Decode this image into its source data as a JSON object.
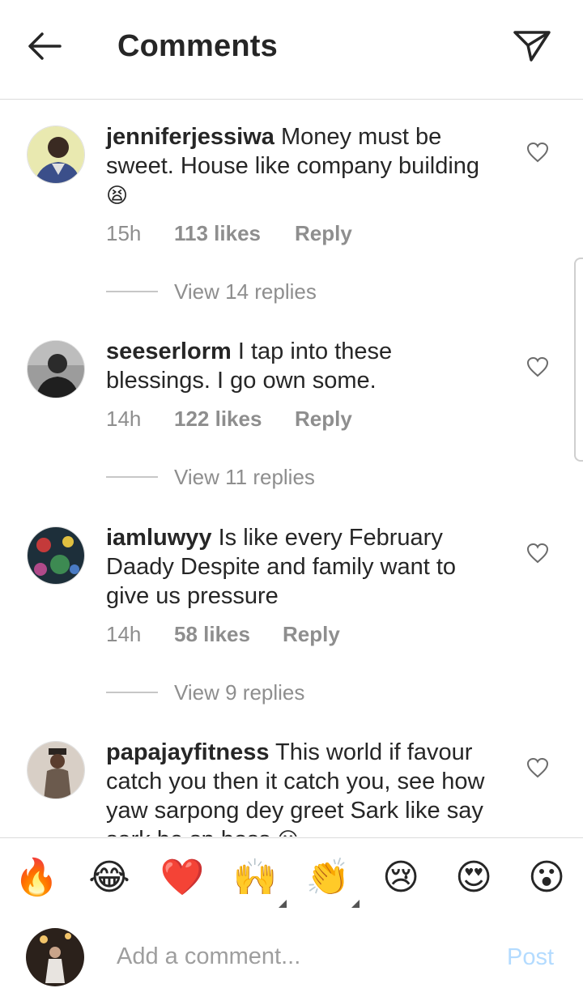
{
  "header": {
    "title": "Comments",
    "back_icon": "arrow-left-icon",
    "send_icon": "paper-plane-icon"
  },
  "comments": [
    {
      "username": "jenniferjessiwa",
      "text": "Money must be sweet. House like company building",
      "emoji": "😫",
      "time": "15h",
      "likes": "113 likes",
      "reply": "Reply",
      "view_replies": "View 14 replies"
    },
    {
      "username": "seeserlorm",
      "text": "I tap into these blessings. I go own some.",
      "time": "14h",
      "likes": "122 likes",
      "reply": "Reply",
      "view_replies": "View 11 replies"
    },
    {
      "username": "iamluwyy",
      "text": "Is like every February Daady Despite and family want to give us pressure",
      "time": "14h",
      "likes": "58 likes",
      "reply": "Reply",
      "view_replies": "View 9 replies"
    },
    {
      "username": "papajayfitness",
      "text": "This world if favour catch you then it catch you, see how yaw sarpong dey greet Sark like say sark be sp boss",
      "emoji": "😶"
    }
  ],
  "reactions": [
    "🔥",
    "😂",
    "❤️",
    "🙌",
    "👏",
    "😢",
    "😍",
    "😮"
  ],
  "composer": {
    "placeholder": "Add a comment...",
    "post_label": "Post"
  },
  "colors": {
    "text": "#262626",
    "secondary": "#8e8e8e",
    "divider": "#dbdbdb",
    "post_disabled": "#b3dbff"
  }
}
